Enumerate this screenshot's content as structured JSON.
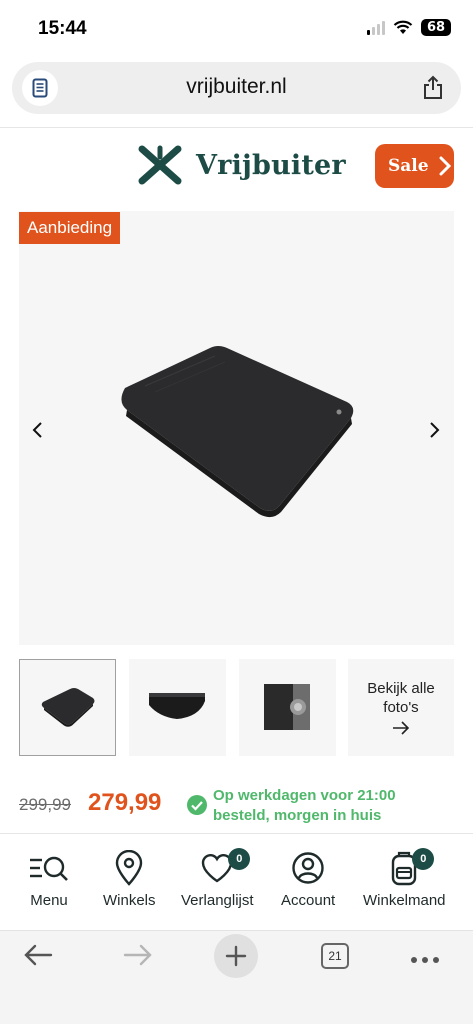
{
  "status_bar": {
    "time": "15:44",
    "battery": "68"
  },
  "browser": {
    "url": "vrijbuiter.nl"
  },
  "header": {
    "brand": "Vrijbuiter",
    "sale_label": "Sale"
  },
  "product": {
    "badge": "Aanbieding",
    "view_all_line1": "Bekijk alle",
    "view_all_line2": "foto's",
    "old_price": "299,99",
    "new_price": "279,99",
    "delivery_line1": "Op werkdagen voor 21:00",
    "delivery_line2": "besteld, morgen in huis"
  },
  "bottom_nav": {
    "items": [
      {
        "label": "Menu",
        "icon": "menu-search-icon"
      },
      {
        "label": "Winkels",
        "icon": "location-pin-icon"
      },
      {
        "label": "Verlanglijst",
        "icon": "heart-icon",
        "count": "0"
      },
      {
        "label": "Account",
        "icon": "user-icon"
      },
      {
        "label": "Winkelmand",
        "icon": "backpack-icon",
        "count": "0"
      }
    ]
  },
  "toolbar": {
    "tabs_count": "21"
  },
  "colors": {
    "accent": "#e0531c",
    "brand": "#1c4c45",
    "success": "#4fb86b"
  }
}
